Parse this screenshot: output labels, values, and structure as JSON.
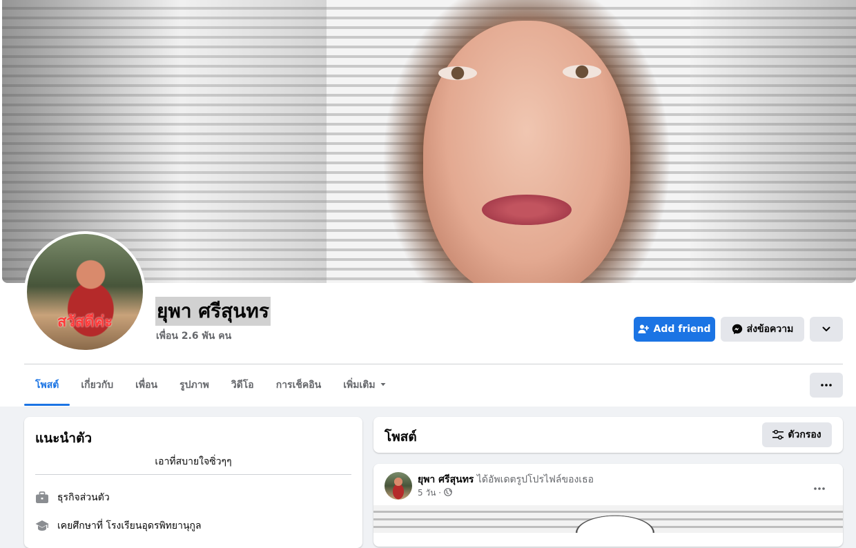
{
  "profile": {
    "name": "ยุพา ศรีสุนทร",
    "friends_count": "เพื่อน 2.6 พัน คน",
    "avatar_text": "สวัสดีค่ะ"
  },
  "actions": {
    "add_friend": "Add friend",
    "message": "ส่งข้อความ"
  },
  "tabs": [
    {
      "label": "โพสต์",
      "active": true
    },
    {
      "label": "เกี่ยวกับ"
    },
    {
      "label": "เพื่อน"
    },
    {
      "label": "รูปภาพ"
    },
    {
      "label": "วิดีโอ"
    },
    {
      "label": "การเช็คอิน"
    },
    {
      "label": "เพิ่มเติม"
    }
  ],
  "intro": {
    "title": "แนะนำตัว",
    "bio": "เอาที่สบายใจซิ่วๆๆ",
    "items": [
      {
        "icon": "briefcase-icon",
        "text": "ธุรกิจส่วนตัว"
      },
      {
        "icon": "graduation-cap-icon",
        "text": "เคยศึกษาที่ โรงเรียนอุดรพิทยานุกูล"
      }
    ]
  },
  "posts": {
    "title": "โพสต์",
    "filter_label": "ตัวกรอง",
    "first": {
      "author": "ยุพา ศรีสุนทร",
      "action": "ได้อัพเดตรูปโปรไฟล์ของเธอ",
      "time": "5 วัน ·"
    }
  },
  "colors": {
    "accent": "#1b74e4",
    "page_bg": "#f0f2f5",
    "secondary_text": "#65676b"
  }
}
